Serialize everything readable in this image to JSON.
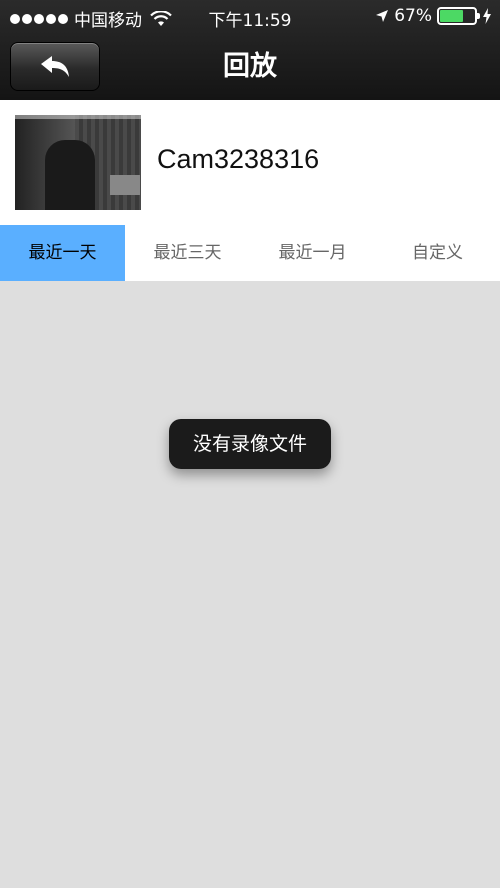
{
  "status_bar": {
    "carrier": "中国移动",
    "time": "下午11:59",
    "battery": "67%",
    "battery_level": 0.67,
    "battery_color": "#4cd964"
  },
  "nav": {
    "title": "回放",
    "back_icon": "back-arrow-icon"
  },
  "device": {
    "name": "Cam3238316"
  },
  "tabs": [
    {
      "label": "最近一天",
      "active": true
    },
    {
      "label": "最近三天",
      "active": false
    },
    {
      "label": "最近一月",
      "active": false
    },
    {
      "label": "自定义",
      "active": false
    }
  ],
  "toast": {
    "message": "没有录像文件"
  },
  "colors": {
    "accent": "#5aafff",
    "background": "#dedede"
  }
}
